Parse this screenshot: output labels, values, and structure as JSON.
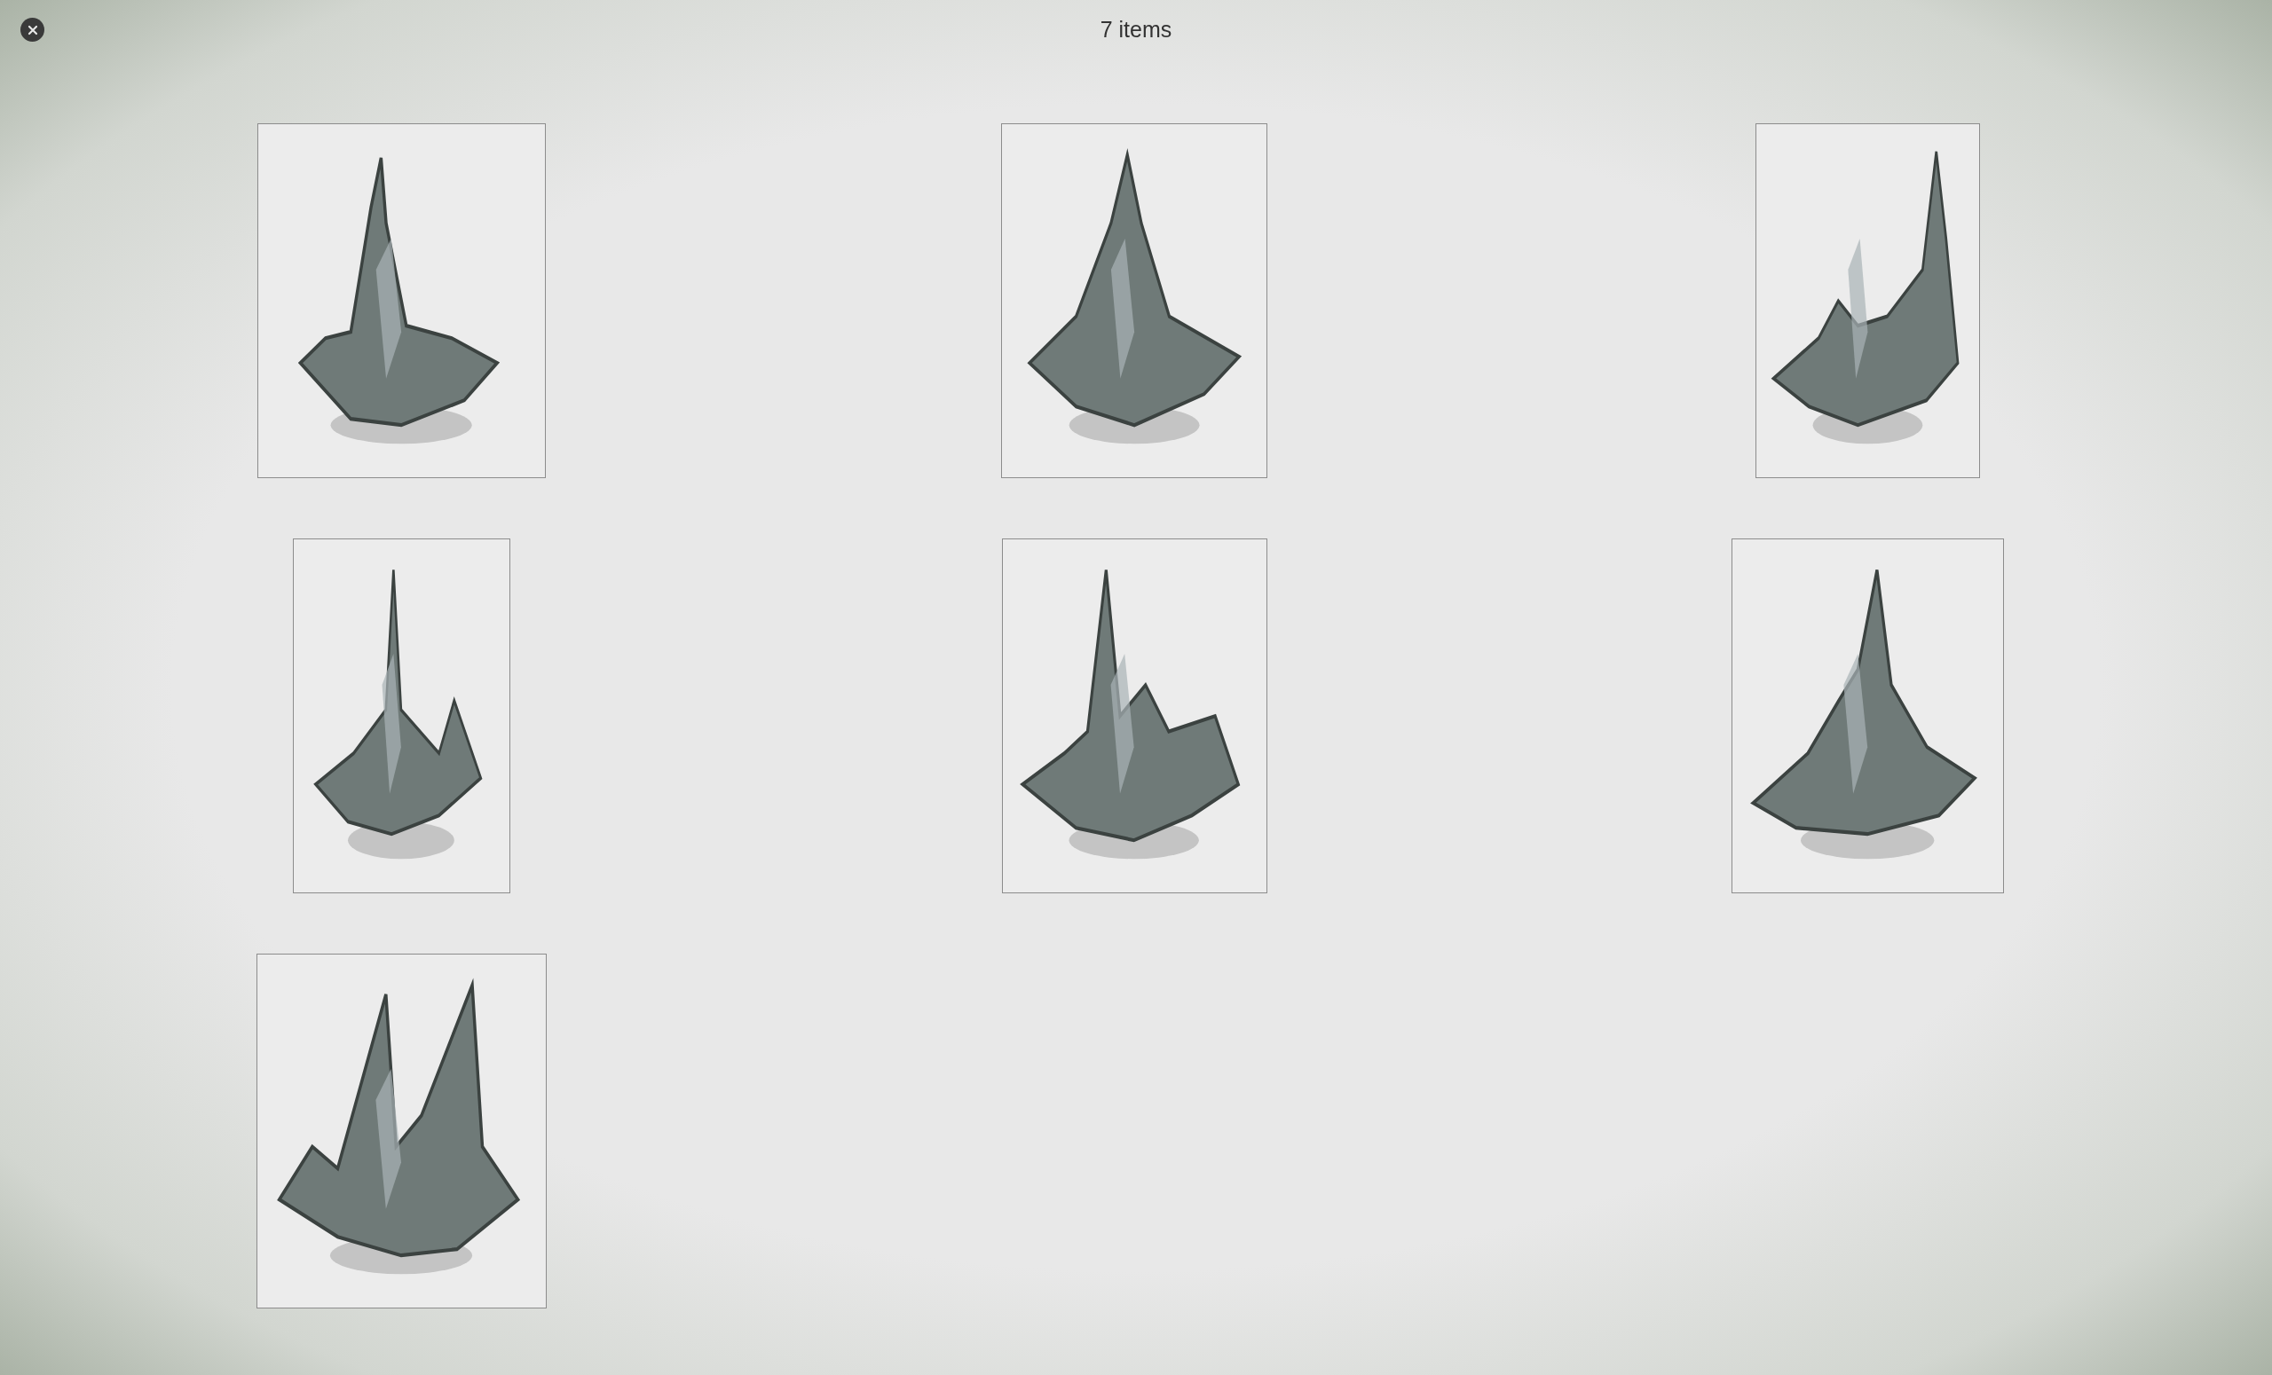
{
  "title": "7 items",
  "thumbnails": [
    {
      "kind": "image"
    },
    {
      "kind": "image"
    },
    {
      "kind": "image"
    },
    {
      "kind": "image"
    },
    {
      "kind": "image"
    },
    {
      "kind": "image"
    },
    {
      "kind": "image"
    }
  ]
}
